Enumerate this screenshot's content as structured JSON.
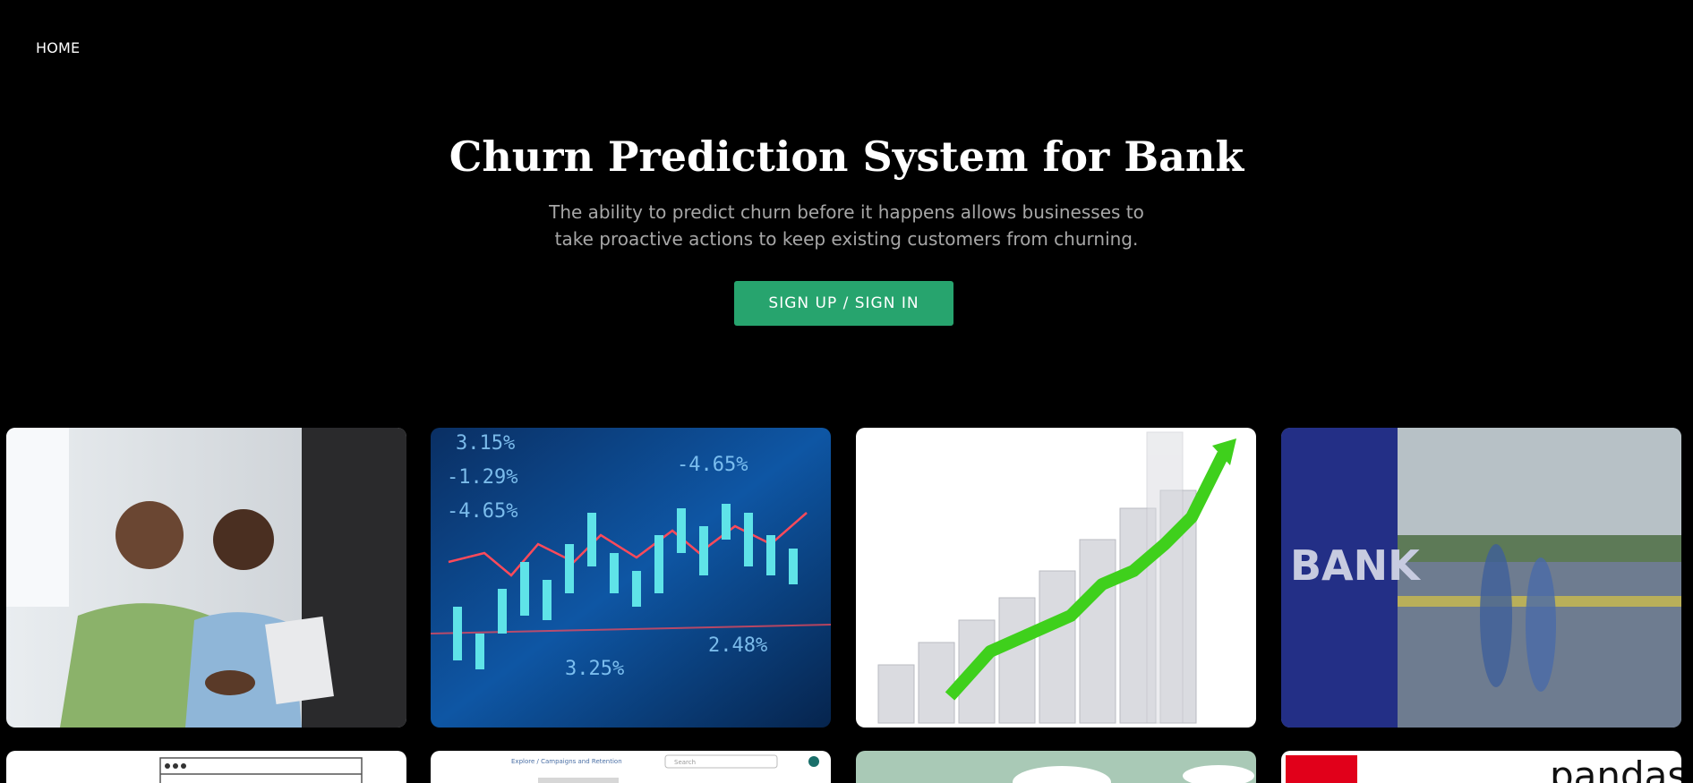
{
  "nav": {
    "home_label": "HOME"
  },
  "hero": {
    "title": "Churn Prediction System for Bank",
    "subtitle": "The ability to predict churn before it happens allows businesses to take proactive actions to keep existing customers from churning.",
    "cta_label": "SIGN UP / SIGN IN"
  },
  "colors": {
    "accent": "#27a46e",
    "background": "#000000",
    "subtitle": "#a7a7a7"
  },
  "gallery": {
    "row1": [
      {
        "image": "people-handshake"
      },
      {
        "image": "stock-candlestick-chart",
        "labels": [
          "3.15%",
          "-1.29%",
          "-4.65%",
          "-4.65%",
          "3.25%",
          "2.48%"
        ]
      },
      {
        "image": "growth-bar-chart-arrow"
      },
      {
        "image": "bank-sign-street",
        "sign": "BANK"
      }
    ],
    "row2": [
      {
        "image": "browser-window-sketch"
      },
      {
        "image": "app-screenshot",
        "labels": [
          "Explore / Campaigns and Retention",
          "Search"
        ]
      },
      {
        "image": "cloud-illustration"
      },
      {
        "image": "library-logos",
        "text": "pandas"
      }
    ]
  }
}
